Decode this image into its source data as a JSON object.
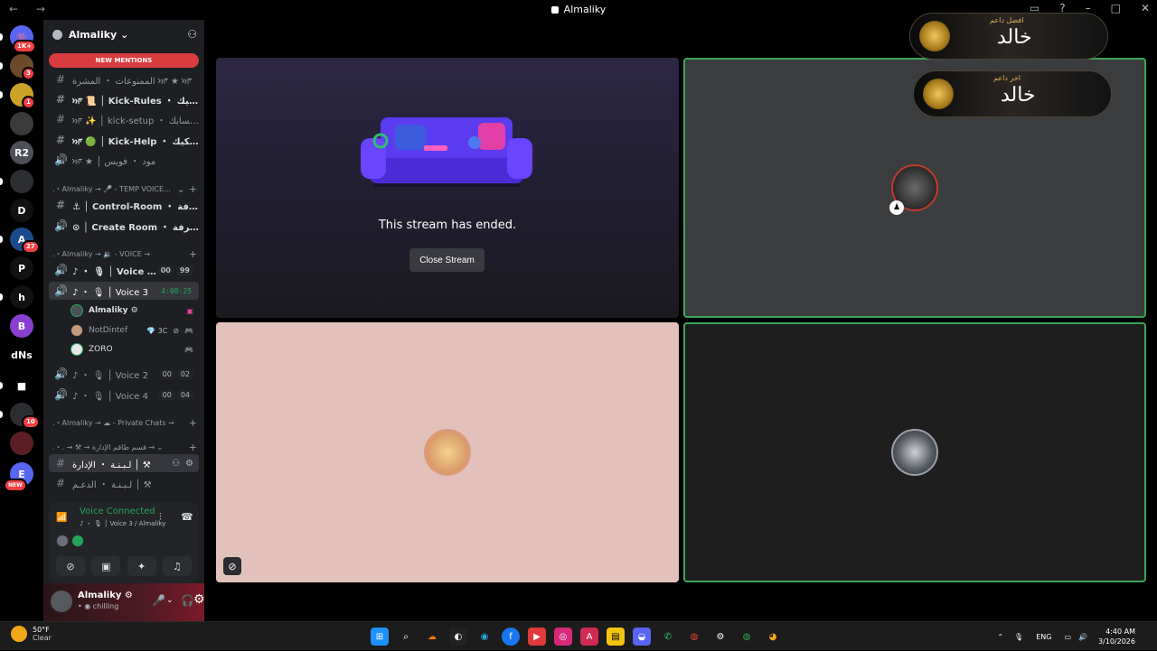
{
  "window": {
    "title": "Almaliky",
    "nav": "← →"
  },
  "servers": [
    {
      "label": "👾",
      "badge": "1K+",
      "color": "#5865f2"
    },
    {
      "label": "",
      "badge": "3",
      "color": "#6b4a2a"
    },
    {
      "label": "",
      "badge": "1",
      "color": "#c9a227"
    },
    {
      "label": "",
      "badge": "",
      "color": "#3a3a3a"
    },
    {
      "label": "R2",
      "badge": "",
      "color": "#4e5058"
    },
    {
      "label": "",
      "badge": "",
      "color": "#2b2d31"
    },
    {
      "label": "D",
      "badge": "",
      "color": "#111"
    },
    {
      "label": "A",
      "badge": "27",
      "color": "#1c4b8c"
    },
    {
      "label": "P",
      "badge": "",
      "color": "#111"
    },
    {
      "label": "h",
      "badge": "",
      "color": "#111"
    },
    {
      "label": "B",
      "badge": "",
      "color": "#8a3fd1"
    },
    {
      "label": "dNs",
      "badge": "",
      "color": "#000"
    },
    {
      "label": "■",
      "badge": "",
      "color": "#000"
    },
    {
      "label": "",
      "badge": "10",
      "color": "#2b2d31"
    },
    {
      "label": "",
      "badge": "",
      "color": "#5a1e24"
    },
    {
      "label": "E",
      "badge": "NEW",
      "color": "#5865f2"
    }
  ],
  "guild": {
    "name": "Almaliky ⌄",
    "new_mentions": "NEW MENTIONS"
  },
  "channels": {
    "c1": "الممنوعات ・ المشرة ਆ ★ ਆ",
    "c2": "ਆ 📜 │ Kick-Rules ・ الكيك-...",
    "c3": "ਆ ✨ │ kick-setup ・ حسابك-...",
    "c4": "ਆ 🟢 │ Kick-Help ・ دعم-الكيك",
    "c5": "ਆ ★ │ مود ・ فويس",
    "cat1": ".・Almaliky → 🎤 - TEMP VOICE...",
    "c6": "⚓ │ Control-Room ・ الغرفة...",
    "c7": "⊙ │ Create Room ・ انشاء غرفة...",
    "cat2": ".・Almaliky → 🔉 - VOICE →",
    "v1": "♪ ・ 🎙 │ Voice 99",
    "v1c": [
      "00",
      "99"
    ],
    "v2": "♪ ・ 🎙 │ Voice 3",
    "v2t": "4:08:25",
    "u1": "Almaliky ⚙",
    "u2": "NotDintef",
    "u2b": "💎 3C",
    "u3": "ZORO",
    "v3": "♪ ・ 🎙 │ Voice 2",
    "v3c": [
      "00",
      "02"
    ],
    "v4": "♪ ・ 🎙 │ Voice 4",
    "v4c": [
      "00",
      "04"
    ],
    "cat3": ".・Almaliky → ☁ - Private Chats →",
    "cat4": ".・. → ⚒ → قسم طاقم الإدارة → ⌄",
    "c8": "لـبـنـة ・ الإدارة │ ⚒",
    "c9": "لـبـنـة ・ الدعـم │ ⚒"
  },
  "voice": {
    "title": "Voice Connected",
    "sub": "♪ ・ 🎙 │ Voice 3 / Almaliky"
  },
  "user": {
    "name": "Almaliky ⚙",
    "status": "• ◉ chilling"
  },
  "stage": {
    "ended": "This stream has ended.",
    "close": "Close Stream"
  },
  "banners": [
    {
      "small": "افضل داعم",
      "big": "خالد"
    },
    {
      "small": "اخر داعم",
      "big": "خالد"
    }
  ],
  "taskbar": {
    "temp": "50°F",
    "weather": "Clear",
    "lang": "ENG",
    "time": "4:40 AM",
    "date": "3/10/2026"
  },
  "colors": {
    "accent": "#23a55a",
    "danger": "#d83c3e",
    "speaking": "#3ba55c"
  }
}
